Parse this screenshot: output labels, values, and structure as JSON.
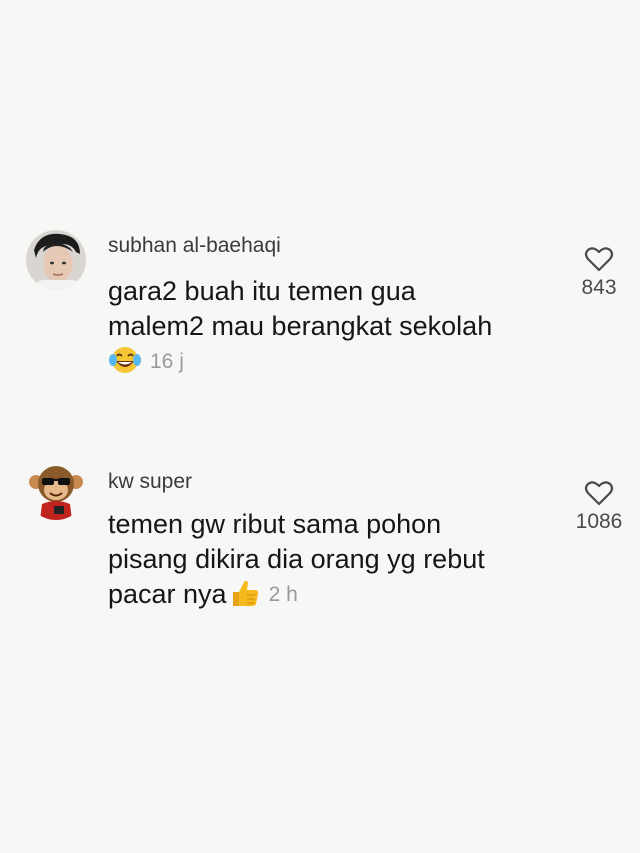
{
  "comments": [
    {
      "username": "subhan al-baehaqi",
      "lines": [
        "gara2 buah itu temen gua",
        "malem2 mau berangkat sekolah"
      ],
      "trailing_text": "",
      "reaction_icon": "laughing-tears-emoji-icon",
      "time": "16 j",
      "like_count": "843"
    },
    {
      "username": "kw super",
      "lines": [
        "temen gw ribut sama pohon",
        "pisang dikira dia orang yg rebut"
      ],
      "trailing_text": "pacar nya",
      "reaction_icon": "thumbs-up-emoji-icon",
      "time": "2 h",
      "like_count": "1086"
    }
  ],
  "colors": {
    "background": "#f7f8f6",
    "text": "#161616",
    "username": "#3a3a3a",
    "meta": "#9a9a9a"
  }
}
